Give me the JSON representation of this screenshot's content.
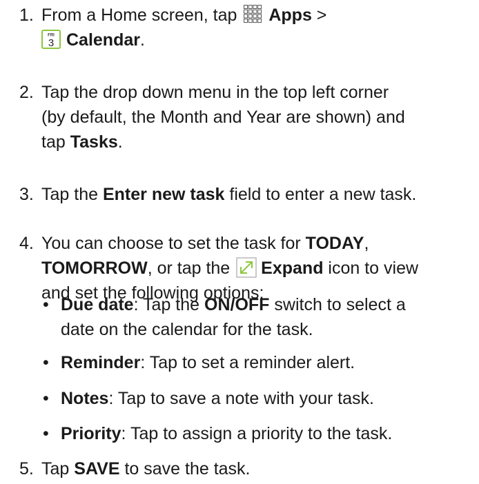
{
  "steps": [
    {
      "num": "1.",
      "from_home": "From a Home screen, tap",
      "apps": "Apps",
      "gt": ">",
      "calendar": "Calendar",
      "period": "."
    },
    {
      "num": "2.",
      "line1": "Tap the drop down menu in the top left corner",
      "line2": "(by default, the Month and Year are shown) and",
      "tap": "tap",
      "tasks": "Tasks",
      "period": "."
    },
    {
      "num": "3.",
      "tap_the": "Tap the",
      "field": "Enter new task",
      "rest": "field to enter a new task."
    },
    {
      "num": "4.",
      "intro": "You can choose to set the task for",
      "today": "TODAY",
      "comma": ",",
      "tomorrow": "TOMORROW",
      "or_tap": ", or tap the",
      "expand": "Expand",
      "icon_to_view": "icon to view",
      "line3": "and set the following options:"
    },
    {
      "num": "5.",
      "tap": "Tap",
      "save": "SAVE",
      "rest": "to save the task."
    }
  ],
  "options": [
    {
      "bullet": "•",
      "label": "Due date",
      "text1": ": Tap the",
      "onoff": "ON/OFF",
      "text2": "switch to select a",
      "line2": "date on the calendar for the task."
    },
    {
      "bullet": "•",
      "label": "Reminder",
      "text": ": Tap to set a reminder alert."
    },
    {
      "bullet": "•",
      "label": "Notes",
      "text": ": Tap to save a note with your task."
    },
    {
      "bullet": "•",
      "label": "Priority",
      "text": ": Tap to assign a priority to the task."
    }
  ],
  "icons": {
    "apps": "apps-grid-icon",
    "calendar": "calendar-icon",
    "calendar_day": "FRI",
    "calendar_date": "3",
    "expand": "expand-icon"
  },
  "colors": {
    "text": "#1a1a1a",
    "calendar_green": "#8cc63f",
    "expand_green": "#8cc63f"
  }
}
